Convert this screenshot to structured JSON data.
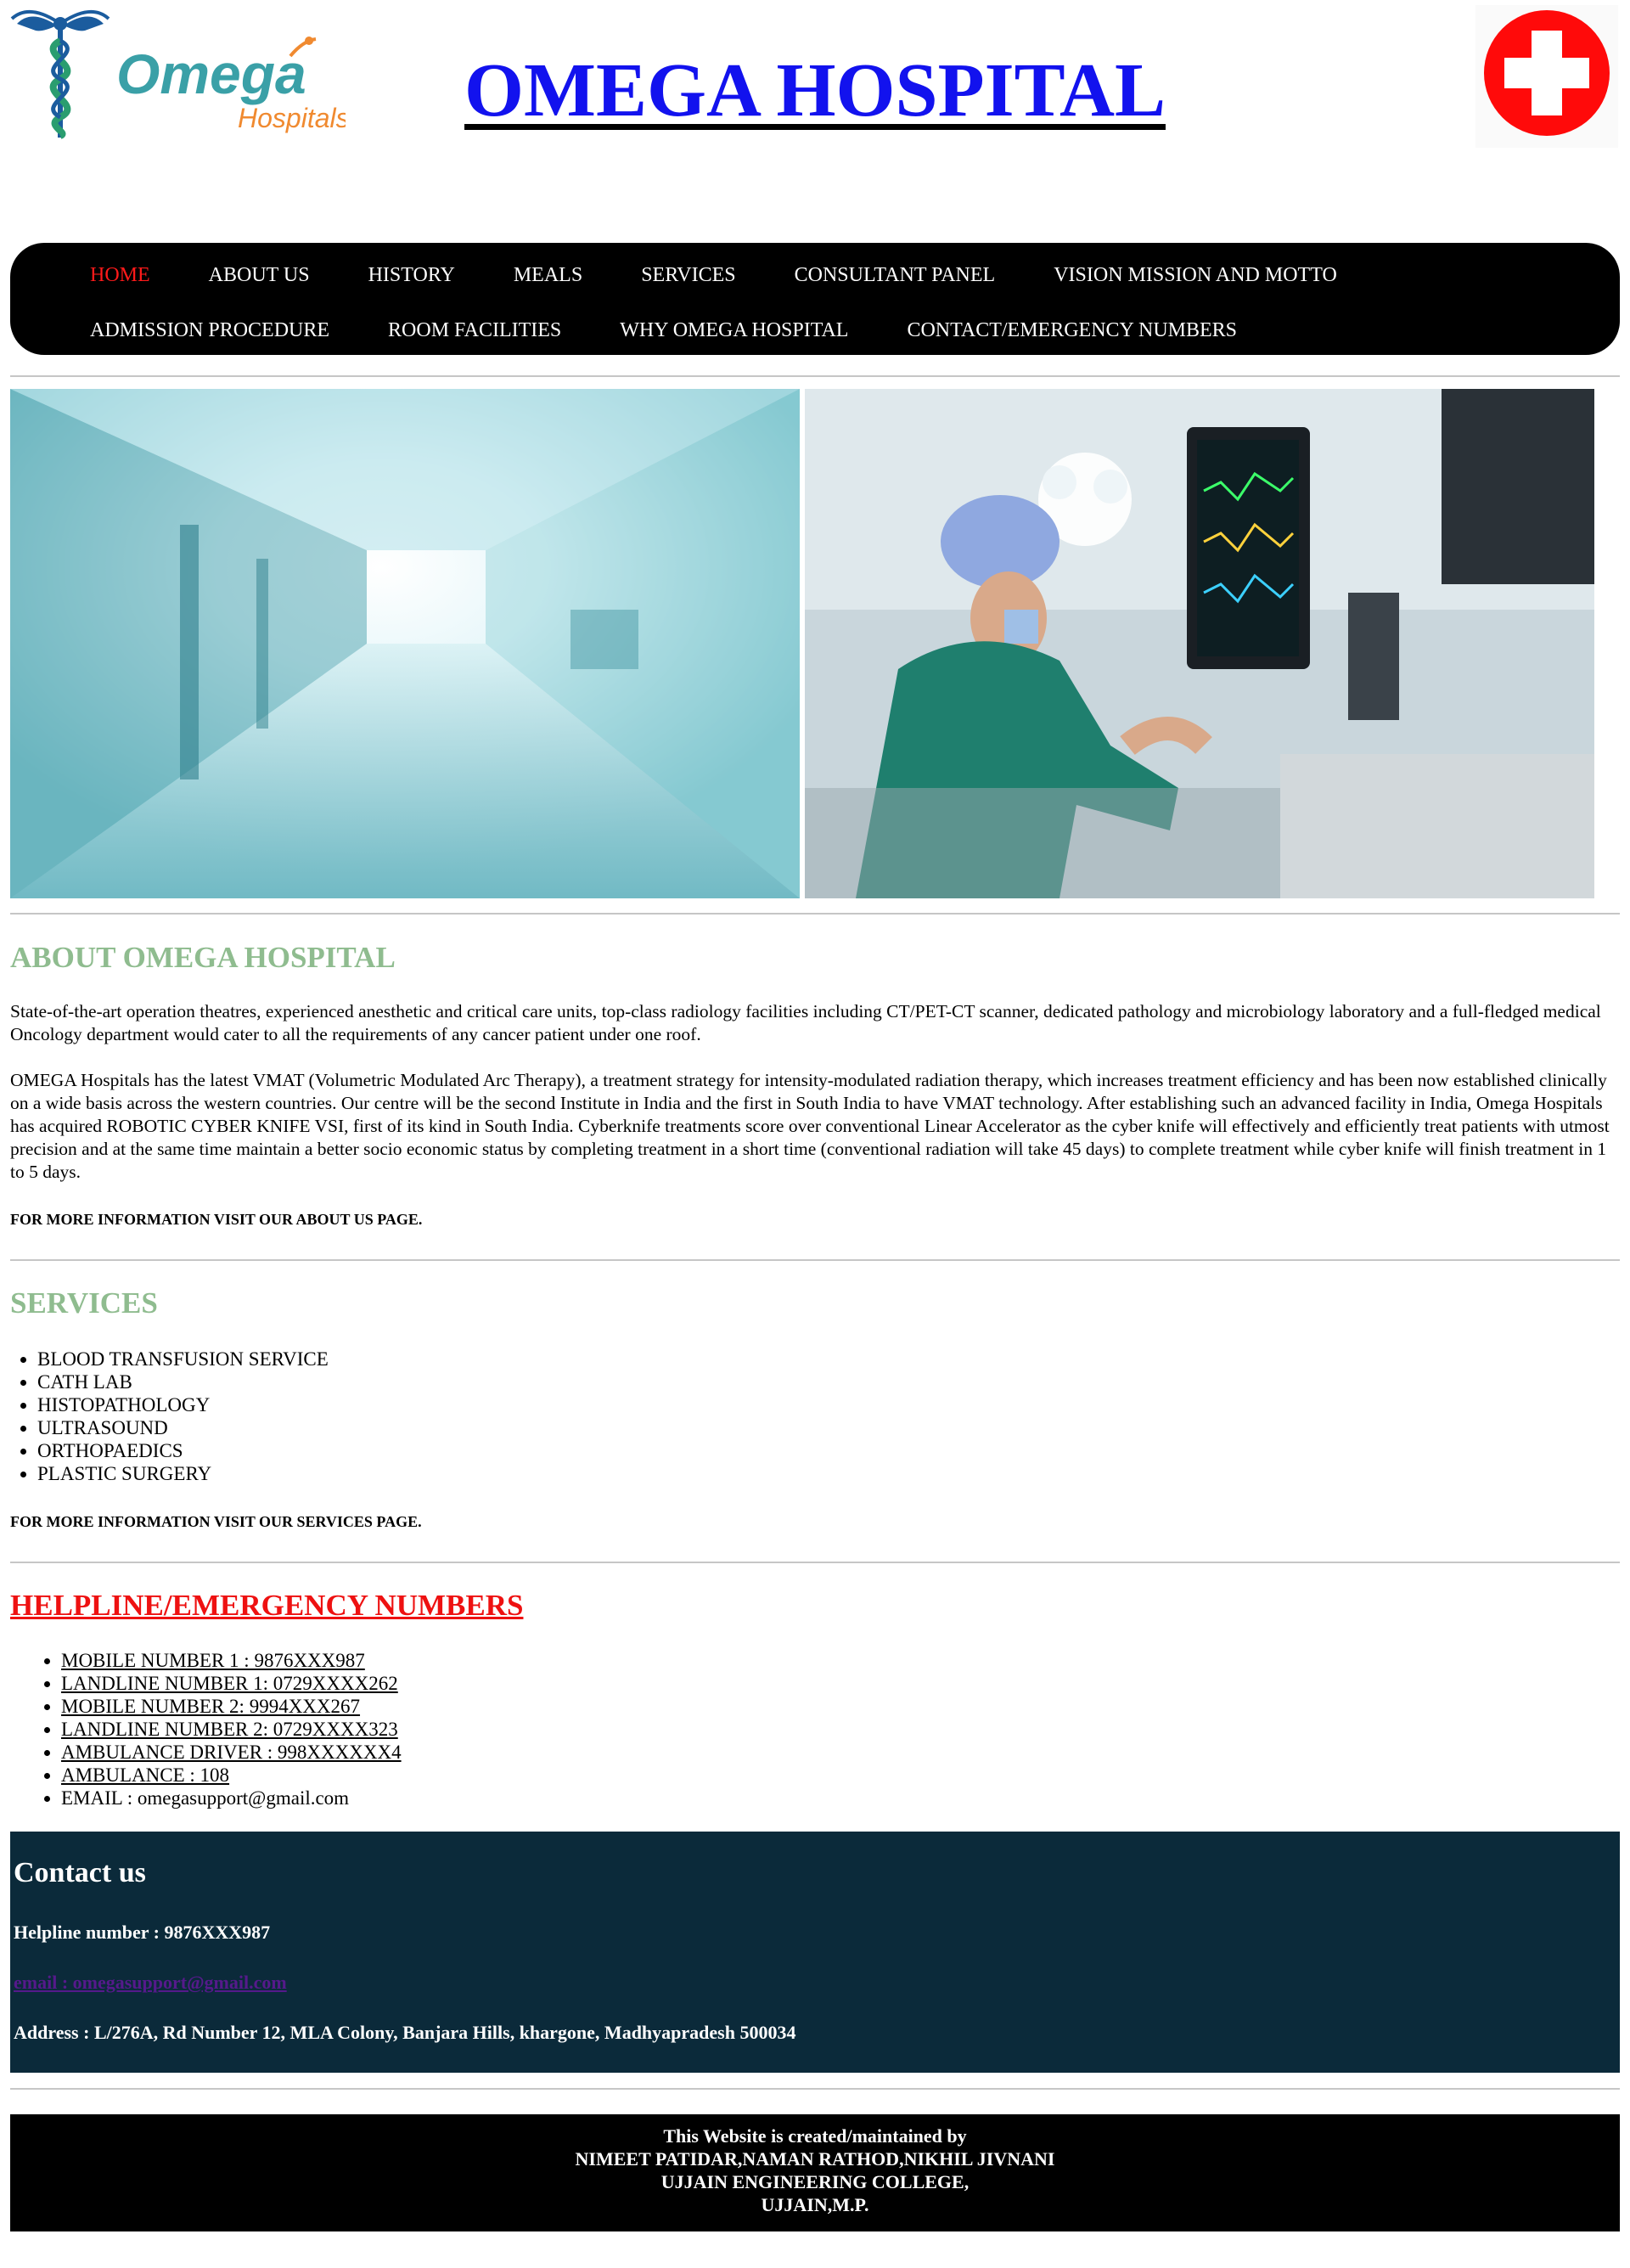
{
  "header": {
    "logo_text": "Omega",
    "logo_subtext": "Hospitals",
    "title": "OMEGA HOSPITAL",
    "badge_icon": "red-cross-icon"
  },
  "nav": {
    "row1": [
      "HOME",
      "ABOUT US",
      "HISTORY",
      "MEALS",
      "SERVICES",
      "CONSULTANT PANEL",
      "VISION MISSION AND MOTTO"
    ],
    "row2": [
      "ADMISSION PROCEDURE",
      "ROOM FACILITIES",
      "WHY OMEGA HOSPITAL",
      "CONTACT/EMERGENCY NUMBERS"
    ],
    "active": "HOME"
  },
  "about": {
    "heading": "ABOUT OMEGA HOSPITAL",
    "para1": "State-of-the-art operation theatres, experienced anesthetic and critical care units, top-class radiology facilities including CT/PET-CT scanner, dedicated pathology and microbiology laboratory and a full-fledged medical Oncology department would cater to all the requirements of any cancer patient under one roof.",
    "para2": "OMEGA Hospitals has the latest VMAT (Volumetric Modulated Arc Therapy), a treatment strategy for intensity-modulated radiation therapy, which increases treatment efficiency and has been now established clinically on a wide basis across the western countries. Our centre will be the second Institute in India and the first in South India to have VMAT technology. After establishing such an advanced facility in India, Omega Hospitals has acquired ROBOTIC CYBER KNIFE VSI, first of its kind in South India. Cyberknife treatments score over conventional Linear Accelerator as the cyber knife will effectively and efficiently treat patients with utmost precision and at the same time maintain a better socio economic status by completing treatment in a short time (conventional radiation will take 45 days) to complete treatment while cyber knife will finish treatment in 1 to 5 days.",
    "note": "FOR MORE INFORMATION VISIT OUR ABOUT US PAGE."
  },
  "services": {
    "heading": "SERVICES",
    "items": [
      "BLOOD TRANSFUSION SERVICE",
      "CATH LAB",
      "HISTOPATHOLOGY",
      "ULTRASOUND",
      "ORTHOPAEDICS",
      "PLASTIC SURGERY"
    ],
    "note": "FOR MORE INFORMATION VISIT OUR SERVICES PAGE."
  },
  "helpline": {
    "heading": "HELPLINE/EMERGENCY NUMBERS",
    "items": [
      "MOBILE NUMBER 1 : 9876XXX987",
      "LANDLINE NUMBER 1: 0729XXXX262",
      "MOBILE NUMBER 2: 9994XXX267",
      "LANDLINE NUMBER 2: 0729XXXX323",
      "AMBULANCE DRIVER : 998XXXXXX4",
      "AMBULANCE : 108"
    ],
    "email": "EMAIL : omegasupport@gmail.com"
  },
  "contact": {
    "title": "Contact us",
    "helpline": "Helpline number : 9876XXX987",
    "email": "email : omegasupport@gmail.com",
    "address": "Address : L/276A, Rd Number 12, MLA Colony, Banjara Hills, khargone, Madhyapradesh 500034"
  },
  "footer": {
    "line1": "This Website is created/maintained by",
    "line2": "NIMEET PATIDAR,NAMAN RATHOD,NIKHIL JIVNANI",
    "line3": "UJJAIN ENGINEERING COLLEGE,",
    "line4": "UJJAIN,M.P."
  },
  "colors": {
    "heading_green": "#8fbc8f",
    "helpline_red": "#ee1111",
    "title_blue": "#1212ee",
    "contact_bg": "#0b2a3a",
    "nav_bg": "#000000"
  }
}
